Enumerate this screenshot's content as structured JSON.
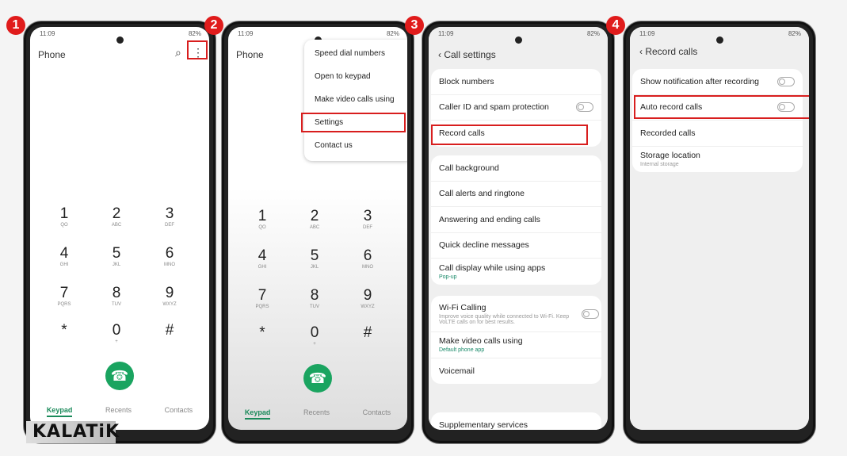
{
  "steps": [
    "1",
    "2",
    "3",
    "4"
  ],
  "status": {
    "time": "11:09",
    "battery": "82%"
  },
  "phone1": {
    "title": "Phone",
    "search_icon": "search-icon",
    "more_icon": "more-vert-icon"
  },
  "keypad": [
    {
      "d": "1",
      "l": "QO"
    },
    {
      "d": "2",
      "l": "ABC"
    },
    {
      "d": "3",
      "l": "DEF"
    },
    {
      "d": "4",
      "l": "GHI"
    },
    {
      "d": "5",
      "l": "JKL"
    },
    {
      "d": "6",
      "l": "MNO"
    },
    {
      "d": "7",
      "l": "PQRS"
    },
    {
      "d": "8",
      "l": "TUV"
    },
    {
      "d": "9",
      "l": "WXYZ"
    },
    {
      "d": "*",
      "l": ""
    },
    {
      "d": "0",
      "l": "+"
    },
    {
      "d": "#",
      "l": ""
    }
  ],
  "tabs": {
    "keypad": "Keypad",
    "recents": "Recents",
    "contacts": "Contacts"
  },
  "menu": [
    "Speed dial numbers",
    "Open to keypad",
    "Make video calls using",
    "Settings",
    "Contact us"
  ],
  "call_settings": {
    "title": "Call settings",
    "group1": [
      {
        "label": "Block numbers"
      },
      {
        "label": "Caller ID and spam protection",
        "toggle": false
      },
      {
        "label": "Record calls"
      }
    ],
    "group2": [
      {
        "label": "Call background"
      },
      {
        "label": "Call alerts and ringtone"
      },
      {
        "label": "Answering and ending calls"
      },
      {
        "label": "Quick decline messages"
      },
      {
        "label": "Call display while using apps",
        "sub": "Pop-up"
      }
    ],
    "group3": [
      {
        "label": "Wi-Fi Calling",
        "sub": "Improve voice quality while connected to Wi-Fi. Keep VoLTE calls on for best results.",
        "toggle": false
      },
      {
        "label": "Make video calls using",
        "sub": "Default phone app"
      },
      {
        "label": "Voicemail"
      }
    ],
    "group4": [
      {
        "label": "Supplementary services"
      }
    ]
  },
  "record_calls": {
    "title": "Record calls",
    "items": [
      {
        "label": "Show notification after recording",
        "toggle": false
      },
      {
        "label": "Auto record calls",
        "toggle": false
      },
      {
        "label": "Recorded calls"
      },
      {
        "label": "Storage location",
        "sub": "Internal storage"
      }
    ]
  },
  "watermark": "KALATiK",
  "colors": {
    "accent": "#1aa460",
    "highlight": "#d81e1e"
  }
}
